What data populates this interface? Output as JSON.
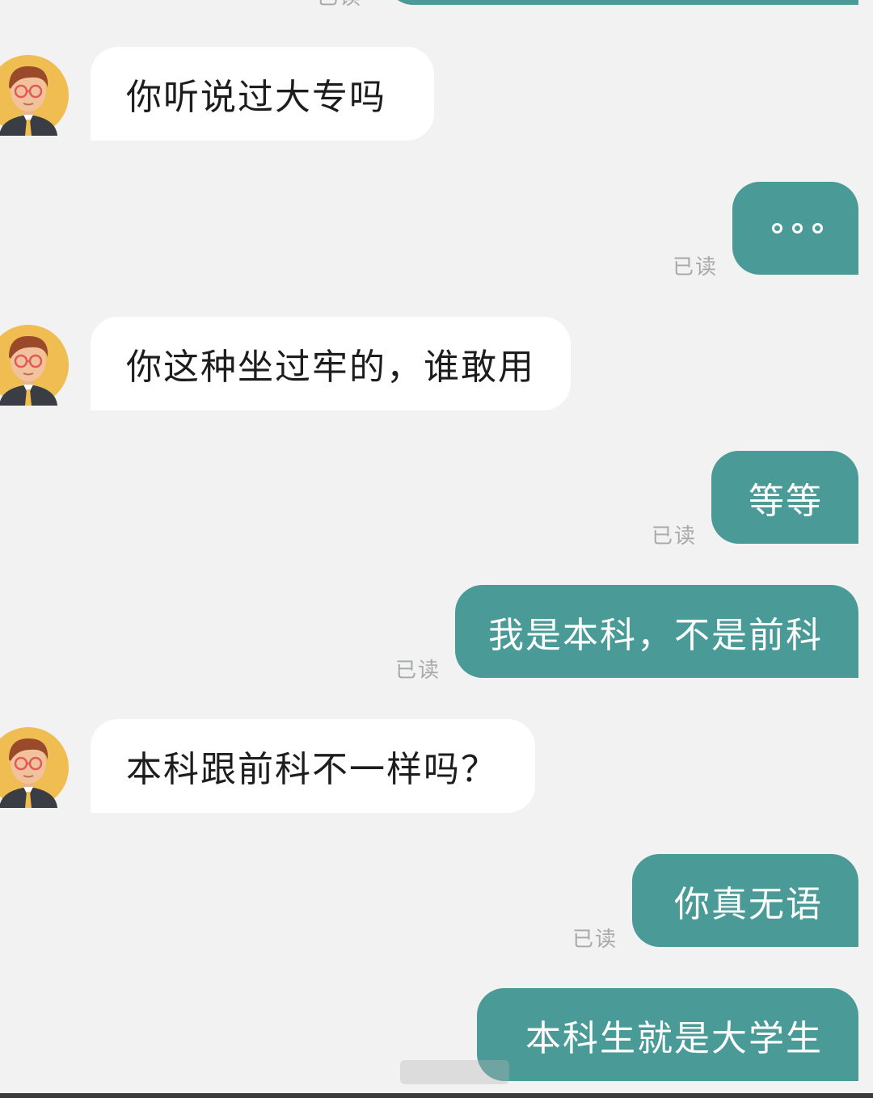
{
  "chat": {
    "colors": {
      "background": "#f1f2f1",
      "incoming_bubble": "#ffffff",
      "outgoing_bubble": "#4a9b98",
      "read_receipt": "#a8aaa9"
    },
    "read_label": "已读",
    "messages": [
      {
        "from": "other",
        "text": "你听说过大专吗"
      },
      {
        "from": "me",
        "text": "",
        "icon": "ellipsis-icon",
        "read": "已读"
      },
      {
        "from": "other",
        "text": "你这种坐过牢的，谁敢用"
      },
      {
        "from": "me",
        "text": "等等",
        "read": "已读"
      },
      {
        "from": "me",
        "text": "我是本科，不是前科",
        "read": "已读"
      },
      {
        "from": "other",
        "text": "本科跟前科不一样吗？"
      },
      {
        "from": "me",
        "text": "你真无语",
        "read": "已读"
      },
      {
        "from": "me",
        "text": "本科生就是大学生"
      }
    ]
  }
}
